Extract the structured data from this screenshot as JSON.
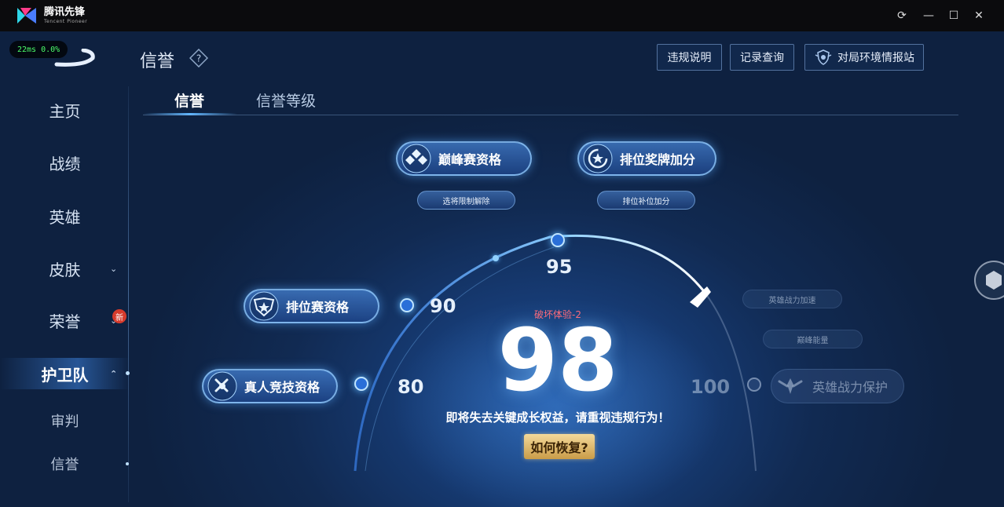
{
  "titlebar": {
    "app_name": "腾讯先锋",
    "app_sub": "Tencent Pioneer",
    "refresh_glyph": "⟳",
    "minimize_glyph": "—",
    "maximize_glyph": "☐",
    "close_glyph": "✕"
  },
  "overlay": {
    "ping": "22ms",
    "loss": "0.0%"
  },
  "header": {
    "title": "信誉",
    "help_glyph": "?",
    "buttons": {
      "violation": "违规说明",
      "records": "记录查询",
      "environment": "对局环境情报站"
    }
  },
  "tabs": {
    "credit": "信誉",
    "level": "信誉等级"
  },
  "sidebar": {
    "items": {
      "home": "主页",
      "record": "战绩",
      "heroes": "英雄",
      "skins": "皮肤",
      "honor": "荣誉",
      "guard": "护卫队",
      "judge": "审判",
      "credit": "信誉"
    },
    "new_badge": "新",
    "chevron_down": "⌄",
    "chevron_up": "⌃"
  },
  "privileges": {
    "peak": {
      "label": "巅峰赛资格",
      "sub": "选将限制解除"
    },
    "rank_medal": {
      "label": "排位奖牌加分",
      "sub": "排位补位加分"
    },
    "rank": {
      "label": "排位赛资格"
    },
    "real": {
      "label": "真人竞技资格"
    },
    "hero_power": {
      "label": "英雄战力保护",
      "sub1": "英雄战力加速",
      "sub2": "巅峰能量"
    }
  },
  "gauge": {
    "ticks": {
      "t80": "80",
      "t90": "90",
      "t95": "95",
      "t100": "100"
    },
    "score": "98",
    "deduction": "破坏体验-2",
    "warning": "即将失去关键成长权益，请重视违规行为！",
    "recover": "如何恢复?"
  },
  "colors": {
    "accent": "#5fb6ff",
    "warning_red": "#ff6b7a",
    "gold": "#d8b066",
    "bg": "#112a52"
  }
}
